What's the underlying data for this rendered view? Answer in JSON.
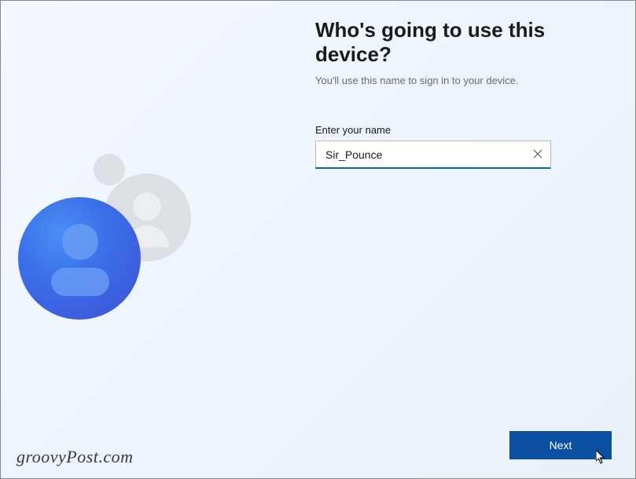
{
  "heading": "Who's going to use this device?",
  "subheading": "You'll use this name to sign in to your device.",
  "field_label": "Enter your name",
  "name_input": {
    "value": "Sir_Pounce"
  },
  "next_button_label": "Next",
  "watermark": "groovyPost.com",
  "colors": {
    "accent": "#0067c0",
    "button": "#0b4fa0"
  }
}
